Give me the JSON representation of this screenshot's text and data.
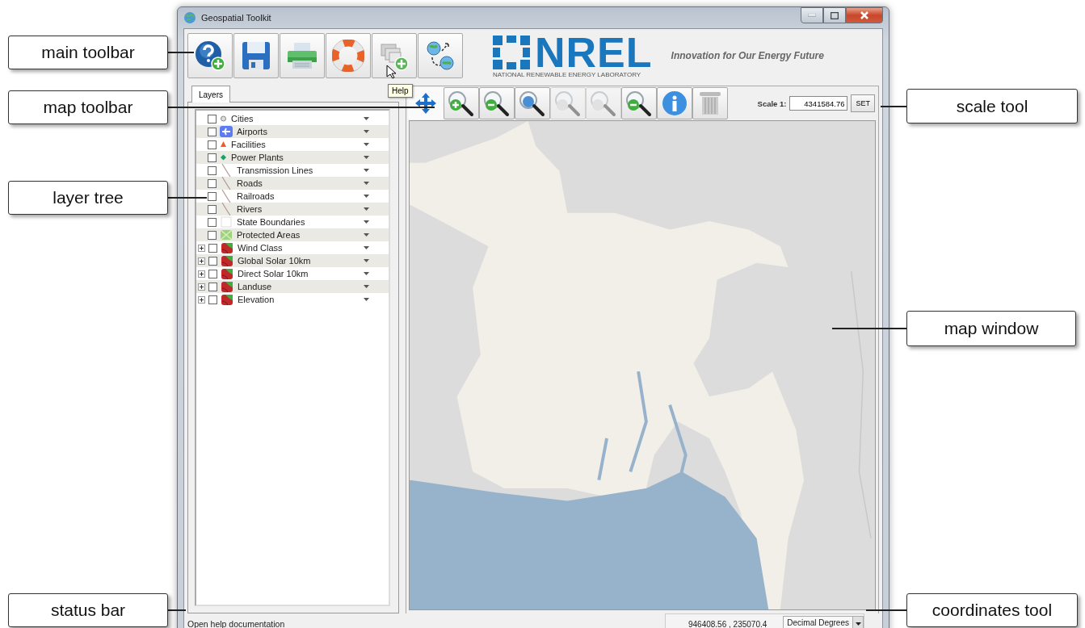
{
  "window": {
    "title": "Geospatial Toolkit"
  },
  "main_toolbar": {
    "buttons": [
      {
        "kind": "help-add"
      },
      {
        "kind": "save"
      },
      {
        "kind": "print"
      },
      {
        "kind": "lifebuoy"
      },
      {
        "kind": "layers-add"
      },
      {
        "kind": "globe-link"
      }
    ],
    "tooltip": "Help"
  },
  "logo": {
    "name": "NREL",
    "subtitle": "NATIONAL RENEWABLE ENERGY LABORATORY",
    "tagline": "Innovation for Our Energy Future"
  },
  "tabs": [
    {
      "label": "Layers",
      "selected": true
    }
  ],
  "layers": [
    {
      "name": "Cities",
      "kind": "dot",
      "checked": false
    },
    {
      "name": "Airports",
      "kind": "plane",
      "checked": false
    },
    {
      "name": "Facilities",
      "kind": "triangle",
      "checked": false
    },
    {
      "name": "Power Plants",
      "kind": "diamond",
      "checked": false
    },
    {
      "name": "Transmission Lines",
      "kind": "line",
      "checked": false
    },
    {
      "name": "Roads",
      "kind": "line",
      "checked": false
    },
    {
      "name": "Railroads",
      "kind": "line",
      "checked": false
    },
    {
      "name": "Rivers",
      "kind": "line",
      "checked": false
    },
    {
      "name": "State Boundaries",
      "kind": "outline",
      "checked": false
    },
    {
      "name": "Protected Areas",
      "kind": "area",
      "checked": false
    },
    {
      "name": "Wind Class",
      "kind": "raster",
      "checked": false,
      "expanded": false
    },
    {
      "name": "Global Solar 10km",
      "kind": "raster",
      "checked": false,
      "expanded": false
    },
    {
      "name": "Direct Solar 10km",
      "kind": "raster",
      "checked": false,
      "expanded": false
    },
    {
      "name": "Landuse",
      "kind": "raster",
      "checked": false,
      "expanded": false
    },
    {
      "name": "Elevation",
      "kind": "raster",
      "checked": false,
      "expanded": false
    }
  ],
  "map_toolbar": {
    "buttons": [
      {
        "kind": "pan",
        "selected": true,
        "disabled": false
      },
      {
        "kind": "zoom-in",
        "selected": false,
        "disabled": false
      },
      {
        "kind": "zoom-out",
        "selected": false,
        "disabled": false
      },
      {
        "kind": "zoom-full",
        "selected": false,
        "disabled": false
      },
      {
        "kind": "zoom-previous",
        "selected": false,
        "disabled": true
      },
      {
        "kind": "zoom-next",
        "selected": false,
        "disabled": true
      },
      {
        "kind": "zoom-layer",
        "selected": false,
        "disabled": false
      },
      {
        "kind": "info",
        "selected": false,
        "disabled": false
      },
      {
        "kind": "clear",
        "selected": false,
        "disabled": false
      }
    ]
  },
  "scale_tool": {
    "label": "Scale 1:",
    "value": "4341584.76",
    "button": "SET"
  },
  "status_bar": {
    "message": "Open help documentation",
    "coordinates": "946408.56 , 235070.4",
    "units": "Decimal Degrees"
  },
  "callouts": [
    {
      "text": "main toolbar"
    },
    {
      "text": "map toolbar"
    },
    {
      "text": "layer tree"
    },
    {
      "text": "status bar"
    },
    {
      "text": "scale tool"
    },
    {
      "text": "map window"
    },
    {
      "text": "coordinates tool"
    }
  ]
}
